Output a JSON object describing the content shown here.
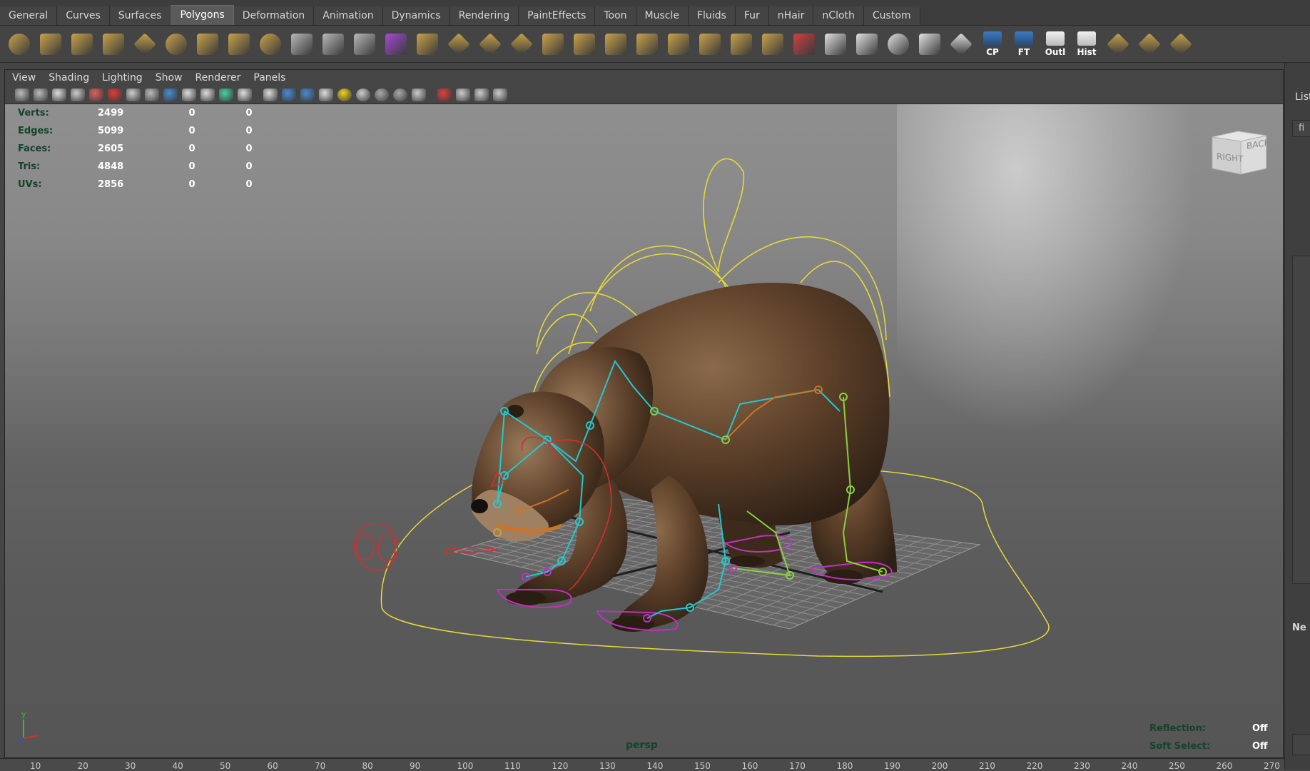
{
  "shelf_tabs": [
    "General",
    "Curves",
    "Surfaces",
    "Polygons",
    "Deformation",
    "Animation",
    "Dynamics",
    "Rendering",
    "PaintEffects",
    "Toon",
    "Muscle",
    "Fluids",
    "Fur",
    "nHair",
    "nCloth",
    "Custom"
  ],
  "active_shelf_tab": "Polygons",
  "shelf_icons": [
    {
      "icon": "poly-sphere-icon",
      "color": "#c9a24a"
    },
    {
      "icon": "poly-cube-icon",
      "color": "#c9a24a"
    },
    {
      "icon": "poly-cylinder-icon",
      "color": "#c9a24a"
    },
    {
      "icon": "poly-cone-icon",
      "color": "#c9a24a"
    },
    {
      "icon": "poly-plane-icon",
      "color": "#c9a24a"
    },
    {
      "icon": "poly-torus-icon",
      "color": "#c9a24a"
    },
    {
      "icon": "poly-pyramid-icon",
      "color": "#c9a24a"
    },
    {
      "icon": "poly-pipe-icon",
      "color": "#c9a24a"
    },
    {
      "icon": "poly-soccer-icon",
      "color": "#c9a24a"
    },
    {
      "icon": "combine-icon",
      "color": "#b8b8b8"
    },
    {
      "icon": "separate-icon",
      "color": "#b8b8b8"
    },
    {
      "icon": "boolean-icon",
      "color": "#b8b8b8"
    },
    {
      "icon": "smooth-cube-icon",
      "color": "#a64ad6"
    },
    {
      "icon": "extrude-icon",
      "color": "#c9a24a"
    },
    {
      "icon": "bridge-icon",
      "color": "#c9a24a"
    },
    {
      "icon": "append-icon",
      "color": "#c9a24a"
    },
    {
      "icon": "split-icon",
      "color": "#c9a24a"
    },
    {
      "icon": "insert-edge-icon",
      "color": "#c9a24a"
    },
    {
      "icon": "offset-icon",
      "color": "#c9a24a"
    },
    {
      "icon": "merge-icon",
      "color": "#c9a24a"
    },
    {
      "icon": "delete-edge-icon",
      "color": "#c9a24a"
    },
    {
      "icon": "bevel-icon",
      "color": "#c9a24a"
    },
    {
      "icon": "wedge-icon",
      "color": "#c9a24a"
    },
    {
      "icon": "poke-icon",
      "color": "#c9a24a"
    },
    {
      "icon": "mirror-icon",
      "color": "#c9a24a"
    },
    {
      "icon": "triangulate-icon",
      "color": "#d04040"
    },
    {
      "icon": "planar-map-icon",
      "color": "#e0e0e0"
    },
    {
      "icon": "cylindrical-map-icon",
      "color": "#e0e0e0"
    },
    {
      "icon": "spherical-map-icon",
      "color": "#e0e0e0"
    },
    {
      "icon": "automatic-map-icon",
      "color": "#e0e0e0"
    },
    {
      "icon": "uv-checker-icon",
      "color": "#e0e0e0"
    }
  ],
  "shelf_labeled_buttons": [
    "CP",
    "FT",
    "Outl",
    "Hist"
  ],
  "shelf_tail_icons": [
    {
      "icon": "uv-layout-icon"
    },
    {
      "icon": "uv-select-icon"
    },
    {
      "icon": "uv-ruler-icon"
    }
  ],
  "panel_menu": [
    "View",
    "Shading",
    "Lighting",
    "Show",
    "Renderer",
    "Panels"
  ],
  "hud_stats": [
    {
      "label": "Verts:",
      "value": "2499",
      "sel": "0",
      "comp": "0"
    },
    {
      "label": "Edges:",
      "value": "5099",
      "sel": "0",
      "comp": "0"
    },
    {
      "label": "Faces:",
      "value": "2605",
      "sel": "0",
      "comp": "0"
    },
    {
      "label": "Tris:",
      "value": "4848",
      "sel": "0",
      "comp": "0"
    },
    {
      "label": "UVs:",
      "value": "2856",
      "sel": "0",
      "comp": "0"
    }
  ],
  "view_cube": {
    "right": "RIGHT",
    "back": "BACK"
  },
  "hud_right": [
    {
      "label": "Reflection:",
      "value": "Off"
    },
    {
      "label": "Soft Select:",
      "value": "Off"
    }
  ],
  "camera_name": "persp",
  "axis": {
    "y": "y"
  },
  "right_panel": {
    "label": "List",
    "item": "fi",
    "footer": "Ne"
  },
  "timeline_ticks": [
    "10",
    "20",
    "30",
    "40",
    "50",
    "60",
    "70",
    "80",
    "90",
    "100",
    "110",
    "120",
    "130",
    "140",
    "150",
    "160",
    "170",
    "180",
    "190",
    "200",
    "210",
    "220",
    "230",
    "240",
    "250",
    "260",
    "270"
  ],
  "colors": {
    "hud_label": "#14432a",
    "rig_yellow": "#e6d83a",
    "rig_cyan": "#22c8d0",
    "rig_green": "#8ad040",
    "rig_red": "#d03030",
    "rig_magenta": "#c030c0",
    "bear_fur": "#6b4a30"
  }
}
